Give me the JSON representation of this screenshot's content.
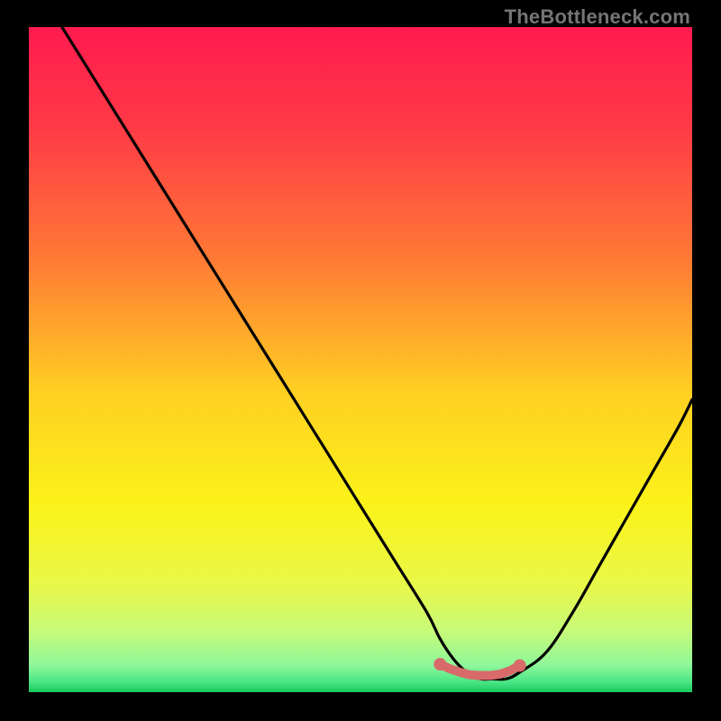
{
  "watermark": "TheBottleneck.com",
  "colors": {
    "frame_bg": "#000000",
    "curve": "#000000",
    "marker": "#d86a6a",
    "gradient_stops": [
      {
        "offset": 0.0,
        "color": "#ff1a4f"
      },
      {
        "offset": 0.15,
        "color": "#ff3a46"
      },
      {
        "offset": 0.35,
        "color": "#ff7a35"
      },
      {
        "offset": 0.55,
        "color": "#ffd022"
      },
      {
        "offset": 0.72,
        "color": "#fbf31a"
      },
      {
        "offset": 0.84,
        "color": "#e8f84a"
      },
      {
        "offset": 0.91,
        "color": "#c6fa7a"
      },
      {
        "offset": 0.96,
        "color": "#8df79a"
      },
      {
        "offset": 0.985,
        "color": "#4ae585"
      },
      {
        "offset": 1.0,
        "color": "#17c95e"
      }
    ]
  },
  "chart_data": {
    "type": "line",
    "title": "",
    "xlabel": "",
    "ylabel": "",
    "xlim": [
      0,
      100
    ],
    "ylim": [
      0,
      100
    ],
    "grid": false,
    "legend": false,
    "series": [
      {
        "name": "bottleneck-curve",
        "x": [
          5,
          10,
          15,
          20,
          25,
          30,
          35,
          40,
          45,
          50,
          55,
          60,
          62,
          64,
          66,
          68,
          70,
          72,
          74,
          78,
          82,
          86,
          90,
          94,
          98,
          100
        ],
        "y": [
          100,
          92,
          84,
          76,
          68,
          60,
          52,
          44,
          36,
          28,
          20,
          12,
          8,
          5,
          3,
          2,
          2,
          2,
          3,
          6,
          12,
          19,
          26,
          33,
          40,
          44
        ]
      }
    ],
    "annotations": [
      {
        "name": "optimal-range-markers",
        "type": "scatter",
        "x": [
          62,
          63.5,
          65,
          66.5,
          68,
          69.5,
          71,
          72.5,
          74
        ],
        "y": [
          4.2,
          3.5,
          3.0,
          2.6,
          2.5,
          2.5,
          2.7,
          3.2,
          4.0
        ]
      }
    ]
  }
}
